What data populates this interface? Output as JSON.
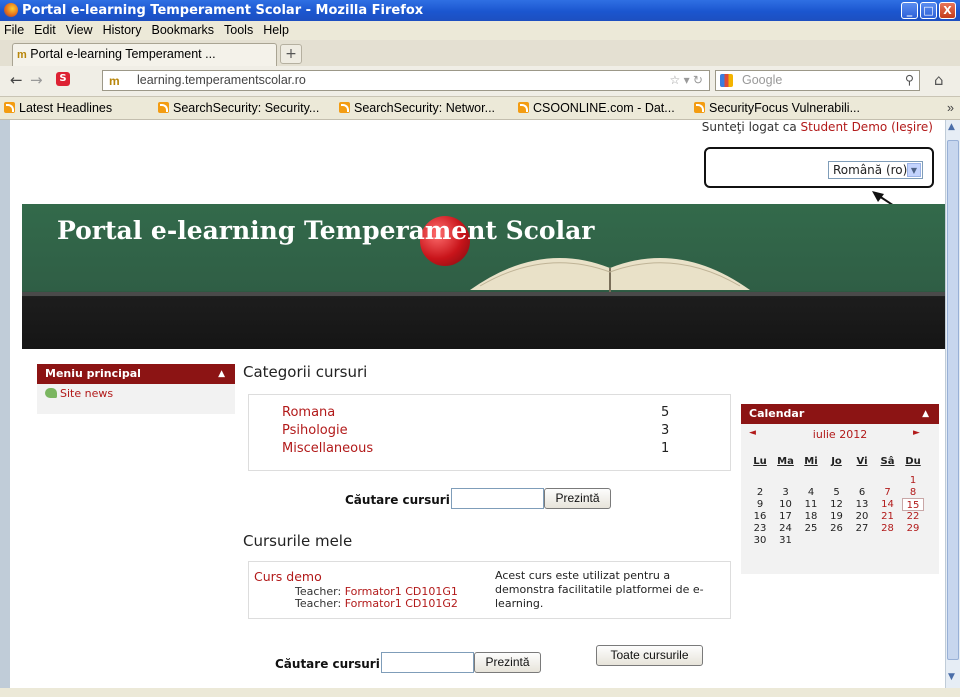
{
  "window": {
    "title": "Portal e-learning Temperament Scolar - Mozilla Firefox",
    "controls": {
      "minimize": "_",
      "maximize": "□",
      "close": "X"
    }
  },
  "menubar": [
    "File",
    "Edit",
    "View",
    "History",
    "Bookmarks",
    "Tools",
    "Help"
  ],
  "tabs": [
    {
      "label": "Portal e-learning Temperament ...",
      "favicon": "m"
    }
  ],
  "newtab_label": "+",
  "nav": {
    "url": "learning.temperamentscolar.ro",
    "search_engine_label": "Google",
    "back_icon": "←",
    "forward_icon": "→",
    "home_icon": "⌂",
    "search_icon": "⚲"
  },
  "bookmarks": [
    "Latest Headlines",
    "SearchSecurity: Security...",
    "SearchSecurity: Networ...",
    "CSOONLINE.com - Dat...",
    "SecurityFocus Vulnerabili..."
  ],
  "bookmarks_more": "»",
  "page": {
    "login": {
      "prefix": "Sunteţi logat ca",
      "user": "Student Demo",
      "logout": "(Ieşire)"
    },
    "language": "Română (ro)",
    "site_title": "Portal e-learning Temperament Scolar",
    "main_menu": {
      "title": "Meniu principal",
      "items": [
        "Site news"
      ]
    },
    "categories": {
      "title": "Categorii cursuri",
      "items": [
        {
          "name": "Romana",
          "count": "5"
        },
        {
          "name": "Psihologie",
          "count": "3"
        },
        {
          "name": "Miscellaneous",
          "count": "1"
        }
      ]
    },
    "search": {
      "label": "Căutare cursuri:",
      "button": "Prezintă"
    },
    "my_courses": {
      "title": "Cursurile mele",
      "course": {
        "name": "Curs demo",
        "teachers": [
          {
            "role": "Teacher:",
            "name": "Formator1 CD101G1"
          },
          {
            "role": "Teacher:",
            "name": "Formator1 CD101G2"
          }
        ],
        "summary": "Acest curs este utilizat pentru a demonstra facilitatile platformei de e-learning."
      }
    },
    "all_courses_button": "Toate cursurile",
    "calendar": {
      "title": "Calendar",
      "month": "iulie 2012",
      "weekdays": [
        "Lu",
        "Ma",
        "Mi",
        "Jo",
        "Vi",
        "Sâ",
        "Du"
      ],
      "weeks": [
        [
          "",
          "",
          "",
          "",
          "",
          "",
          "1"
        ],
        [
          "2",
          "3",
          "4",
          "5",
          "6",
          "7",
          "8"
        ],
        [
          "9",
          "10",
          "11",
          "12",
          "13",
          "14",
          "15"
        ],
        [
          "16",
          "17",
          "18",
          "19",
          "20",
          "21",
          "22"
        ],
        [
          "23",
          "24",
          "25",
          "26",
          "27",
          "28",
          "29"
        ],
        [
          "30",
          "31",
          "",
          "",
          "",
          "",
          ""
        ]
      ],
      "today": "15",
      "prev_icon": "◄",
      "next_icon": "►"
    },
    "collapse_icon": "▲"
  },
  "colors": {
    "accent": "#8c1414",
    "link": "#b21a1a",
    "banner": "#336a4b"
  }
}
